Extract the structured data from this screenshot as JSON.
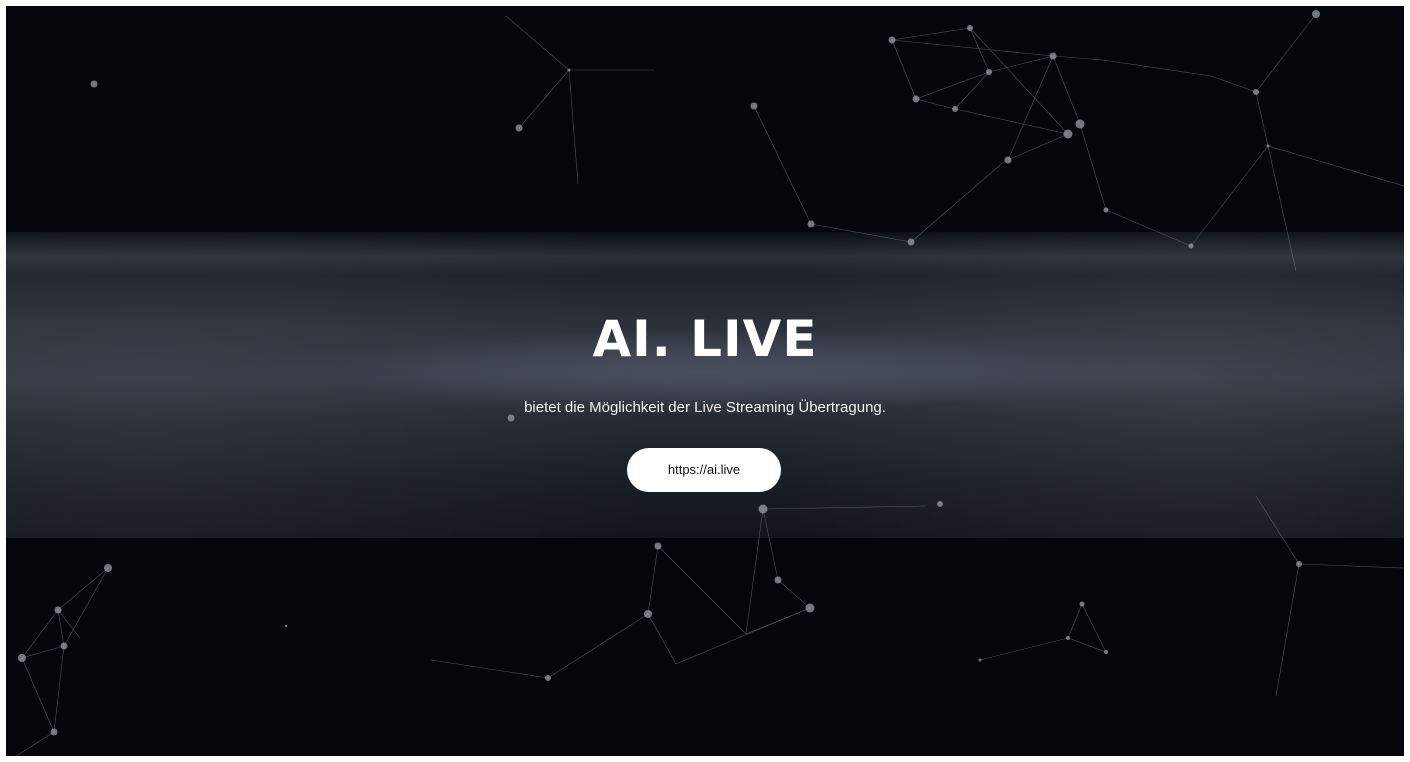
{
  "hero": {
    "title": "AI. LIVE",
    "subtitle": "bietet die Möglichkeit der Live Streaming Übertragung.",
    "button_label": "https://ai.live"
  },
  "colors": {
    "background": "#04060b",
    "text": "#ffffff",
    "button_bg": "#ffffff",
    "button_text": "#111111",
    "network": "#9a9da3"
  }
}
